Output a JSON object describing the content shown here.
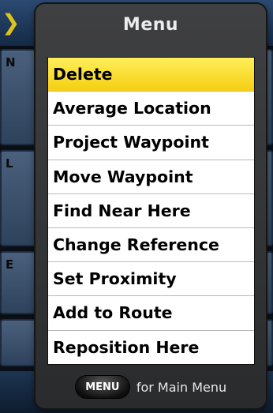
{
  "background": {
    "panel_letters": [
      "N",
      "L",
      "E"
    ],
    "accent_color": "#e0c21a"
  },
  "menu": {
    "title": "Menu",
    "items": [
      {
        "label": "Delete",
        "selected": true
      },
      {
        "label": "Average Location",
        "selected": false
      },
      {
        "label": "Project Waypoint",
        "selected": false
      },
      {
        "label": "Move Waypoint",
        "selected": false
      },
      {
        "label": "Find Near Here",
        "selected": false
      },
      {
        "label": "Change Reference",
        "selected": false
      },
      {
        "label": "Set Proximity",
        "selected": false
      },
      {
        "label": "Add to Route",
        "selected": false
      },
      {
        "label": "Reposition Here",
        "selected": false
      }
    ],
    "selection_color": "#f5cf12",
    "footer": {
      "key_label": "MENU",
      "hint": "for Main Menu"
    }
  }
}
